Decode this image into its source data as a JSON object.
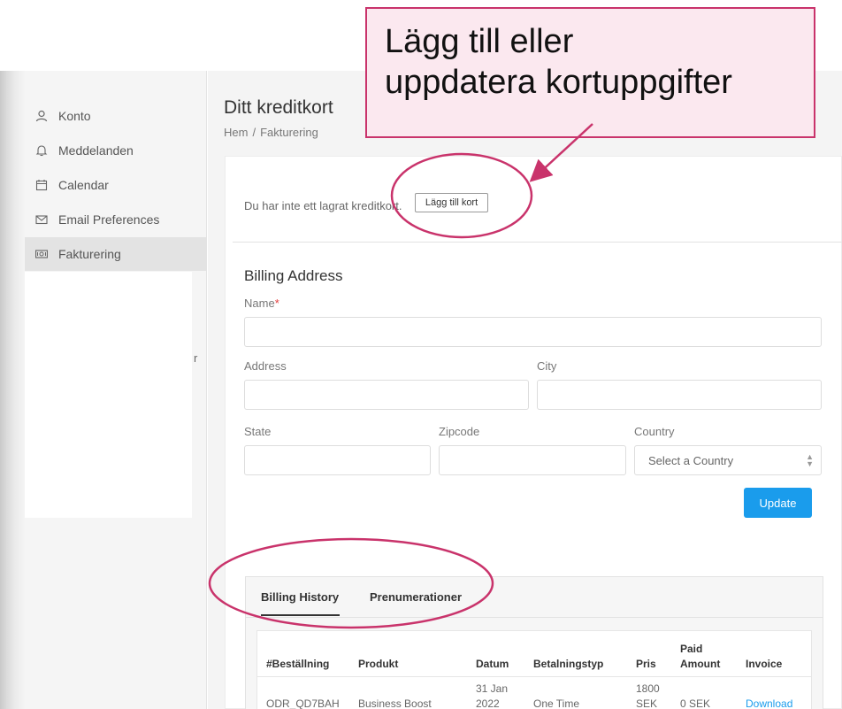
{
  "sidebar": {
    "items": [
      {
        "label": "Konto",
        "icon": "user-icon"
      },
      {
        "label": "Meddelanden",
        "icon": "bell-icon"
      },
      {
        "label": "Calendar",
        "icon": "calendar-icon"
      },
      {
        "label": "Email Preferences",
        "icon": "envelope-icon"
      },
      {
        "label": "Fakturering",
        "icon": "billing-icon"
      }
    ],
    "stray_text": "r"
  },
  "page": {
    "title": "Ditt kreditkort",
    "breadcrumb": {
      "home": "Hem",
      "separator": "/",
      "current": "Fakturering"
    }
  },
  "card_info": {
    "no_card_text": "Du har inte ett lagrat kreditkort.",
    "add_card_label": "Lägg till kort"
  },
  "billing_address": {
    "title": "Billing Address",
    "name_label": "Name",
    "required_mark": "*",
    "address_label": "Address",
    "city_label": "City",
    "state_label": "State",
    "zipcode_label": "Zipcode",
    "country_label": "Country",
    "country_placeholder": "Select a Country",
    "update_label": "Update"
  },
  "tabs": [
    {
      "label": "Billing History",
      "active": true
    },
    {
      "label": "Prenumerationer",
      "active": false
    }
  ],
  "table": {
    "headers": [
      "#Beställning",
      "Produkt",
      "Datum",
      "Betalningstyp",
      "Pris",
      "Paid",
      "Amount",
      "Invoice"
    ],
    "rows": [
      {
        "order": "ODR_QD7BAH",
        "product": "Business Boost",
        "date_line1": "31 Jan",
        "date_line2": "2022",
        "payment_type": "One Time",
        "price_line1": "1800",
        "price_line2": "SEK",
        "paid_amount": "0 SEK",
        "invoice": "Download"
      }
    ]
  },
  "annotation": {
    "line1": "Lägg till eller",
    "line2": "uppdatera kortuppgifter",
    "color": "#c9336b"
  }
}
